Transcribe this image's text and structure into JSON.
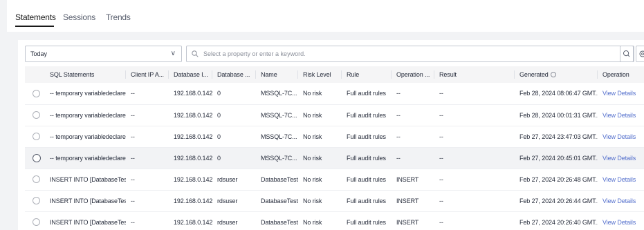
{
  "tabs": [
    {
      "label": "Statements",
      "active": true
    },
    {
      "label": "Sessions",
      "active": false
    },
    {
      "label": "Trends",
      "active": false
    }
  ],
  "filter": {
    "time_range": "Today",
    "search_placeholder": "Select a property or enter a keyword."
  },
  "table": {
    "columns": [
      "SQL Statements",
      "Client IP A...",
      "Database I...",
      "Database ...",
      "Name",
      "Risk Level",
      "Rule",
      "Operation ...",
      "Result",
      "Generated",
      "Operation"
    ],
    "rows": [
      {
        "sql": "-- temporary variabledeclare ...",
        "client_ip": "--",
        "db_ip": "192.168.0.142",
        "db_name": "0",
        "name": "MSSQL-7C...",
        "risk": "No risk",
        "rule": "Full audit rules",
        "op_type": "--",
        "result": "--",
        "generated": "Feb 28, 2024 08:06:47 GMT...",
        "action": "View Details"
      },
      {
        "sql": "-- temporary variabledeclare ...",
        "client_ip": "--",
        "db_ip": "192.168.0.142",
        "db_name": "0",
        "name": "MSSQL-7C...",
        "risk": "No risk",
        "rule": "Full audit rules",
        "op_type": "--",
        "result": "--",
        "generated": "Feb 28, 2024 00:01:31 GMT...",
        "action": "View Details"
      },
      {
        "sql": "-- temporary variabledeclare ...",
        "client_ip": "--",
        "db_ip": "192.168.0.142",
        "db_name": "0",
        "name": "MSSQL-7C...",
        "risk": "No risk",
        "rule": "Full audit rules",
        "op_type": "--",
        "result": "--",
        "generated": "Feb 27, 2024 23:47:03 GMT...",
        "action": "View Details"
      },
      {
        "sql": "-- temporary variabledeclare ...",
        "client_ip": "--",
        "db_ip": "192.168.0.142",
        "db_name": "0",
        "name": "MSSQL-7C...",
        "risk": "No risk",
        "rule": "Full audit rules",
        "op_type": "--",
        "result": "--",
        "generated": "Feb 27, 2024 20:45:01 GMT...",
        "action": "View Details"
      },
      {
        "sql": "INSERT INTO [DatabaseTest...",
        "client_ip": "--",
        "db_ip": "192.168.0.142",
        "db_name": "rdsuser",
        "name": "DatabaseTest",
        "risk": "No risk",
        "rule": "Full audit rules",
        "op_type": "INSERT",
        "result": "--",
        "generated": "Feb 27, 2024 20:26:48 GMT...",
        "action": "View Details"
      },
      {
        "sql": "INSERT INTO [DatabaseTest...",
        "client_ip": "--",
        "db_ip": "192.168.0.142",
        "db_name": "rdsuser",
        "name": "DatabaseTest",
        "risk": "No risk",
        "rule": "Full audit rules",
        "op_type": "INSERT",
        "result": "--",
        "generated": "Feb 27, 2024 20:26:44 GMT...",
        "action": "View Details"
      },
      {
        "sql": "INSERT INTO [DatabaseTest...",
        "client_ip": "--",
        "db_ip": "192.168.0.142",
        "db_name": "rdsuser",
        "name": "DatabaseTest",
        "risk": "No risk",
        "rule": "Full audit rules",
        "op_type": "INSERT",
        "result": "--",
        "generated": "Feb 27, 2024 20:26:40 GMT...",
        "action": "View Details"
      }
    ]
  },
  "colors": {
    "link": "#526ecc",
    "header_bg": "#f5f5f6",
    "page_bg": "#f2f3f5"
  }
}
